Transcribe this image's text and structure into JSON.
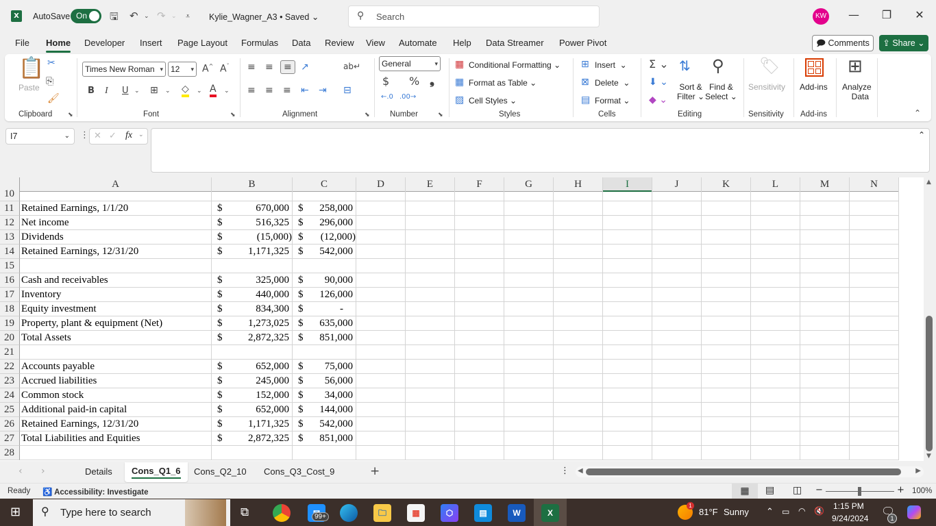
{
  "titlebar": {
    "autosave_label": "AutoSave",
    "autosave_state": "On",
    "file_name": "Kylie_Wagner_A3",
    "save_status": "Saved",
    "search_placeholder": "Search",
    "user_initials": "KW",
    "colors": {
      "brand": "#1d6f42",
      "avatar": "#e3008c"
    }
  },
  "menu": {
    "items": [
      "File",
      "Home",
      "Developer",
      "Insert",
      "Page Layout",
      "Formulas",
      "Data",
      "Review",
      "View",
      "Automate",
      "Help",
      "Data Streamer",
      "Power Pivot"
    ],
    "active": "Home",
    "comments_label": "Comments",
    "share_label": "Share"
  },
  "ribbon": {
    "clipboard": {
      "label": "Clipboard",
      "paste": "Paste"
    },
    "font": {
      "label": "Font",
      "font_name": "Times New Roman",
      "font_size": "12",
      "bold": "B",
      "italic": "I",
      "underline": "U"
    },
    "alignment": {
      "label": "Alignment"
    },
    "number": {
      "label": "Number",
      "format": "General",
      "currency": "$",
      "percent": "%",
      "comma": "❟"
    },
    "styles": {
      "label": "Styles",
      "conditional_formatting": "Conditional Formatting",
      "format_as_table": "Format as Table",
      "cell_styles": "Cell Styles"
    },
    "cells": {
      "label": "Cells",
      "insert": "Insert",
      "delete": "Delete",
      "format": "Format"
    },
    "editing": {
      "label": "Editing",
      "sort_filter_1": "Sort &",
      "sort_filter_2": "Filter",
      "find_select_1": "Find &",
      "find_select_2": "Select"
    },
    "sensitivity": {
      "label": "Sensitivity",
      "button": "Sensitivity"
    },
    "addins": {
      "label": "Add-ins",
      "button": "Add-ins"
    },
    "analyze": {
      "line1": "Analyze",
      "line2": "Data"
    }
  },
  "formula_bar": {
    "name_box": "I7",
    "formula": ""
  },
  "sheet": {
    "columns": [
      "A",
      "B",
      "C",
      "D",
      "E",
      "F",
      "G",
      "H",
      "I",
      "J",
      "K",
      "L",
      "M",
      "N"
    ],
    "selected_column": "I",
    "rows": [
      {
        "n": "10",
        "label": "",
        "b": "",
        "c": ""
      },
      {
        "n": "11",
        "label": "Retained Earnings, 1/1/20",
        "b": "670,000",
        "c": "258,000"
      },
      {
        "n": "12",
        "label": "Net income",
        "b": "516,325",
        "c": "296,000"
      },
      {
        "n": "13",
        "label": "Dividends",
        "b": "(15,000)",
        "c": "(12,000)"
      },
      {
        "n": "14",
        "label": "Retained Earnings, 12/31/20",
        "b": "1,171,325",
        "c": "542,000"
      },
      {
        "n": "15",
        "label": "",
        "b": "",
        "c": ""
      },
      {
        "n": "16",
        "label": "Cash and receivables",
        "b": "325,000",
        "c": "90,000"
      },
      {
        "n": "17",
        "label": "Inventory",
        "b": "440,000",
        "c": "126,000"
      },
      {
        "n": "18",
        "label": "Equity investment",
        "b": "834,300",
        "c": "-"
      },
      {
        "n": "19",
        "label": "Property, plant & equipment (Net)",
        "b": "1,273,025",
        "c": "635,000"
      },
      {
        "n": "20",
        "label": "Total Assets",
        "b": "2,872,325",
        "c": "851,000"
      },
      {
        "n": "21",
        "label": "",
        "b": "",
        "c": ""
      },
      {
        "n": "22",
        "label": "Accounts payable",
        "b": "652,000",
        "c": "75,000"
      },
      {
        "n": "23",
        "label": "Accrued liabilities",
        "b": "245,000",
        "c": "56,000"
      },
      {
        "n": "24",
        "label": "Common stock",
        "b": "152,000",
        "c": "34,000"
      },
      {
        "n": "25",
        "label": "Additional paid-in capital",
        "b": "652,000",
        "c": "144,000"
      },
      {
        "n": "26",
        "label": "Retained Earnings, 12/31/20",
        "b": "1,171,325",
        "c": "542,000"
      },
      {
        "n": "27",
        "label": "Total Liabilities and Equities",
        "b": "2,872,325",
        "c": "851,000"
      },
      {
        "n": "28",
        "label": "",
        "b": "",
        "c": ""
      }
    ],
    "currency_symbol": "$"
  },
  "sheet_tabs": {
    "tabs": [
      "Details",
      "Cons_Q1_6",
      "Cons_Q2_10",
      "Cons_Q3_Cost_9"
    ],
    "active": "Cons_Q1_6",
    "add": "+"
  },
  "statusbar": {
    "ready": "Ready",
    "accessibility": "Accessibility: Investigate",
    "zoom": "100%"
  },
  "taskbar": {
    "search_placeholder": "Type here to search",
    "mail_badge": "99+",
    "weather_temp": "81°F",
    "weather_desc": "Sunny",
    "weather_badge": "1",
    "time": "1:15 PM",
    "date": "9/24/2024",
    "notification_count": "1"
  }
}
